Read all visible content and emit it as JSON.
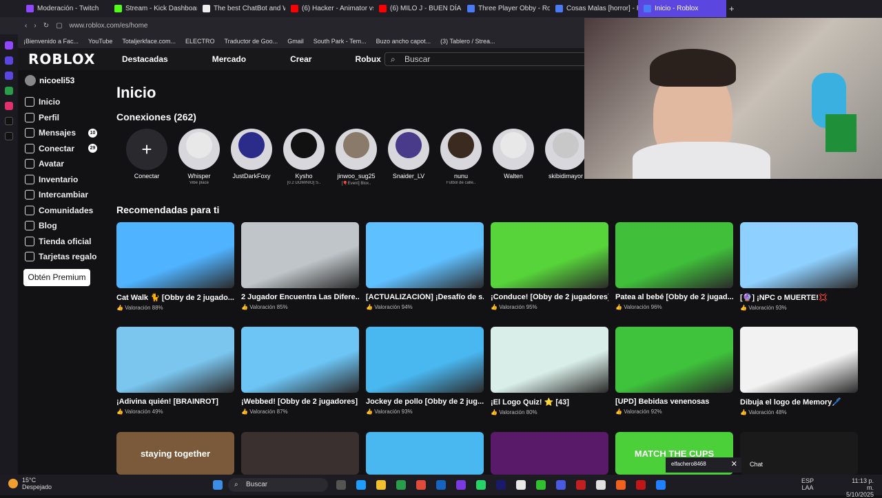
{
  "browser": {
    "tabs": [
      {
        "label": "Moderación - Twitch",
        "color": "#9146ff"
      },
      {
        "label": "Stream - Kick Dashboard",
        "color": "#53fc18"
      },
      {
        "label": "The best ChatBot and W",
        "color": "#eee"
      },
      {
        "label": "(6) Hacker - Animator vs",
        "color": "#ff0000"
      },
      {
        "label": "(6) MILO J - BUEN DÍA P",
        "color": "#ff0000"
      },
      {
        "label": "Three Player Obby - Rob",
        "color": "#4a7bf7"
      },
      {
        "label": "Cosas Malas [horror] - R",
        "color": "#4a7bf7"
      },
      {
        "label": "Inicio - Roblox",
        "color": "#4a7bf7"
      }
    ],
    "url": "www.roblox.com/es/home",
    "bookmarks": [
      "¡Bienvenido a Fac...",
      "YouTube",
      "Totaljerkface.com...",
      "ELECTRO",
      "Traductor de Goo...",
      "Gmail",
      "South Park - Tem...",
      "Buzo ancho capot...",
      "(3) Tablero / Strea..."
    ]
  },
  "roblox": {
    "logo": "ROBLOX",
    "nav": [
      "Destacadas",
      "Mercado",
      "Crear",
      "Robux"
    ],
    "search_placeholder": "Buscar",
    "username": "nicoeli53",
    "sidebar": [
      {
        "label": "Inicio"
      },
      {
        "label": "Perfil"
      },
      {
        "label": "Mensajes",
        "badge": "10"
      },
      {
        "label": "Conectar",
        "badge": "29"
      },
      {
        "label": "Avatar"
      },
      {
        "label": "Inventario"
      },
      {
        "label": "Intercambiar"
      },
      {
        "label": "Comunidades"
      },
      {
        "label": "Blog"
      },
      {
        "label": "Tienda oficial"
      },
      {
        "label": "Tarjetas regalo"
      }
    ],
    "premium_button": "Obtén Premium",
    "page_title": "Inicio",
    "connections_title": "Conexiones (262)",
    "connect_label": "Conectar",
    "connections": [
      {
        "name": "Whisper",
        "sub": "Vibe place"
      },
      {
        "name": "JustDarkFoxy",
        "sub": ""
      },
      {
        "name": "Kysho",
        "sub": "[0.2 DOMINIO] S.."
      },
      {
        "name": "jinwoo_sug25",
        "sub": "[🎈Event] Blox.."
      },
      {
        "name": "Snaider_LV",
        "sub": ""
      },
      {
        "name": "nunu",
        "sub": "Fútbol de calle.."
      },
      {
        "name": "Walten",
        "sub": ""
      },
      {
        "name": "skibidimayor",
        "sub": ""
      }
    ],
    "recommended_title": "Recomendadas para ti",
    "games": [
      {
        "title": "Cat Walk 🐈 [Obby de 2 jugado...",
        "rating": "Valoración 88%",
        "color": "#4fb3ff"
      },
      {
        "title": "2 Jugador Encuentra Las Difere...",
        "rating": "Valoración 85%",
        "color": "#bfc5c9"
      },
      {
        "title": "[ACTUALIZACIÓN] ¡Desafío de s...",
        "rating": "Valoración 94%",
        "color": "#5fc0ff"
      },
      {
        "title": "¡Conduce! [Obby de 2 jugadores]",
        "rating": "Valoración 95%",
        "color": "#57d43a"
      },
      {
        "title": "Patea al bebé [Obby de 2 jugad...",
        "rating": "Valoración 96%",
        "color": "#3fbf3a"
      },
      {
        "title": "[🔮] ¡NPC o MUERTE!💢",
        "rating": "Valoración 93%",
        "color": "#8ed0ff"
      },
      {
        "title": "¡Adivina quién! [BRAINROT]",
        "rating": "Valoración 49%",
        "color": "#7ac6ef"
      },
      {
        "title": "¡Webbed! [Obby de 2 jugadores]",
        "rating": "Valoración 87%",
        "color": "#6cc5f5"
      },
      {
        "title": "Jockey de pollo [Obby de 2 jug...",
        "rating": "Valoración 93%",
        "color": "#49b7f0"
      },
      {
        "title": "¡El Logo Quiz! ⭐ [43]",
        "rating": "Valoración 80%",
        "color": "#d9eee8"
      },
      {
        "title": "[UPD] Bebidas venenosas",
        "rating": "Valoración 92%",
        "color": "#3fc23c"
      },
      {
        "title": "Dibuja el logo de Memory🖊️",
        "rating": "Valoración 48%",
        "color": "#f2f2f2"
      }
    ],
    "row3_colors": [
      "#7a5a3a",
      "#3a3030",
      "#49b7f0",
      "#5a1a6a",
      "#4cd03a",
      "#1a1a1a"
    ],
    "row3_texts": [
      "staying together",
      "",
      "",
      "",
      "MATCH THE CUPS",
      ""
    ]
  },
  "overlay": {
    "chat_user": "elfachero8468",
    "chat_label": "Chat"
  },
  "taskbar": {
    "weather_temp": "15°C",
    "weather_desc": "Despejado",
    "search": "Buscar",
    "lang": "ESP",
    "lang2": "LAA",
    "time": "11:13 p. m.",
    "date": "5/10/2025"
  }
}
